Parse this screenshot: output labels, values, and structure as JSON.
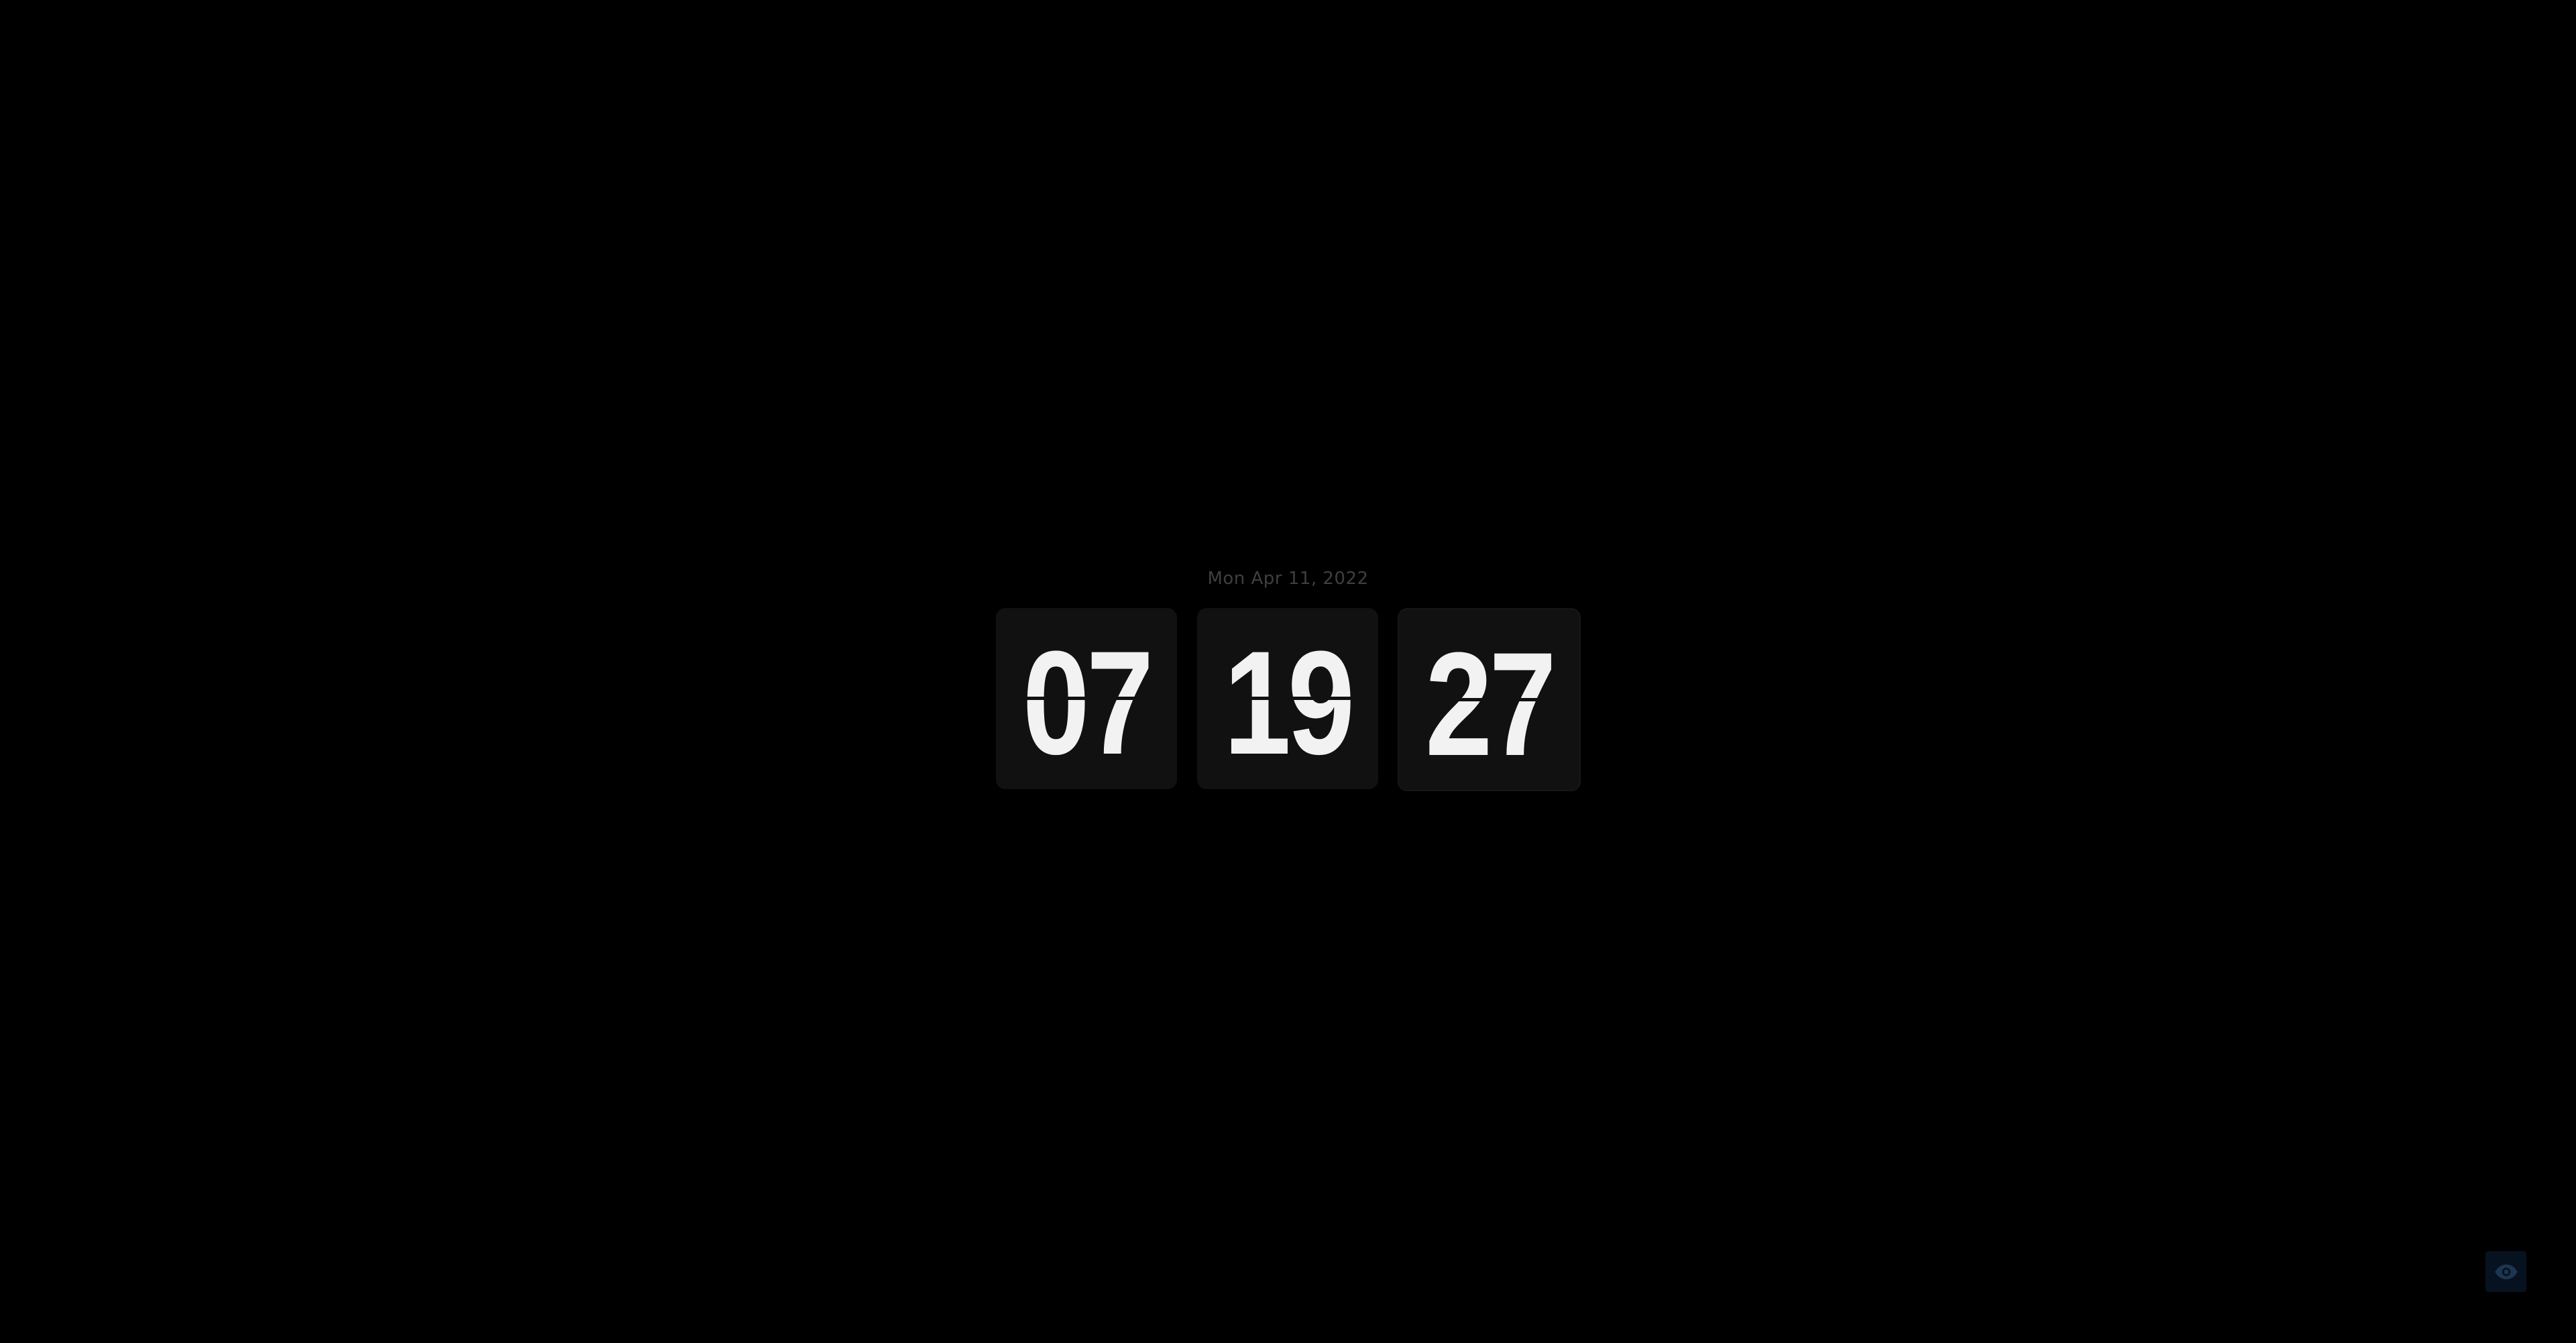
{
  "clock": {
    "date": "Mon Apr 11, 2022",
    "hours": "07",
    "minutes": "19",
    "seconds": "27"
  },
  "controls": {
    "visibility_icon": "eye-icon",
    "accent_color": "#06121f"
  },
  "colors": {
    "background": "#000000",
    "card": "#111111",
    "digit": "#f2f2f2",
    "date_text": "#3f3f3f"
  }
}
